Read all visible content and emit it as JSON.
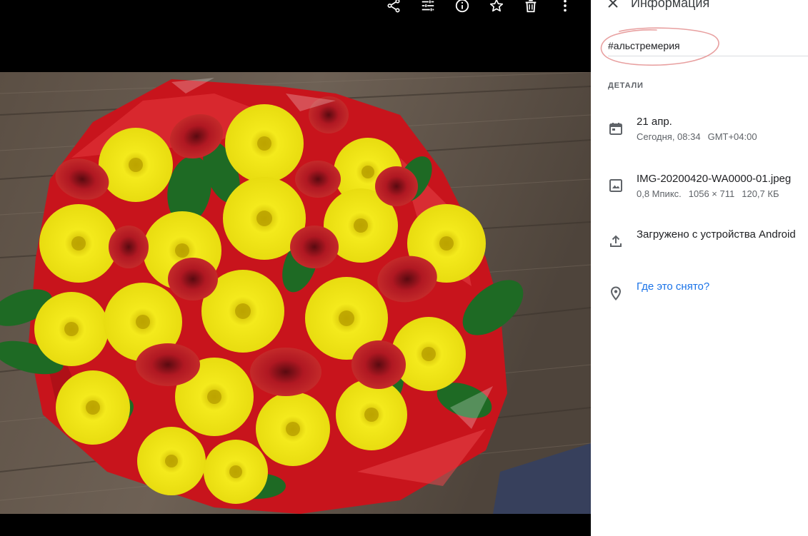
{
  "toolbar": {
    "icons": [
      "share-icon",
      "edit-adjust-icon",
      "info-icon",
      "star-icon",
      "trash-icon",
      "more-vert-icon"
    ]
  },
  "panel": {
    "title": "Информация",
    "description": "#альстремерия",
    "section_label": "ДЕТАЛИ",
    "date": {
      "main": "21 апр.",
      "time": "Сегодня, 08:34",
      "timezone": "GMT+04:00"
    },
    "file": {
      "name": "IMG-20200420-WA0000-01.jpeg",
      "megapixels": "0,8 Мпикс.",
      "dimensions": "1056 × 711",
      "size": "120,7 КБ"
    },
    "upload": {
      "text": "Загружено с устройства Android"
    },
    "location": {
      "link": "Где это снято?"
    }
  },
  "colors": {
    "panel_bg": "#ffffff",
    "viewer_bg": "#000000",
    "link": "#1a73e8",
    "annotation": "#e8a0a0"
  }
}
